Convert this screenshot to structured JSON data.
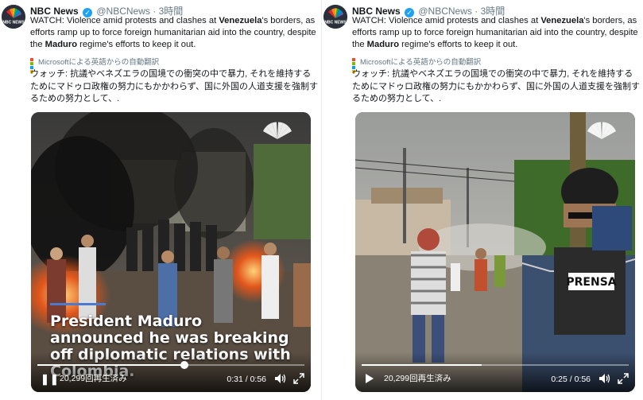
{
  "tweets": [
    {
      "author_name": "NBC News",
      "handle": "@NBCNews",
      "separator": "·",
      "time_ago": "3時間",
      "text_parts": [
        "WATCH: Violence amid protests and clashes at ",
        "Venezuela",
        "'s borders, as efforts ramp up to force foreign humanitarian aid into the country, despite the ",
        "Maduro",
        " regime's efforts to keep it out."
      ],
      "translate_brand": "Microsoft",
      "translate_label": "による英語からの自動翻訳",
      "translated_text": "ウォッチ: 抗議やベネズエラの国境での衝突の中で暴力, それを維持するためにマドゥロ政権の努力にもかかわらず、国に外国の人道支援を強制するための努力として、.",
      "video": {
        "caption": "President Maduro announced he was breaking off diplomatic relations with Colombia.",
        "views": "20,299回再生済み",
        "current_time": "0:31",
        "duration": "0:56",
        "progress_fraction": 0.55,
        "state": "playing"
      }
    },
    {
      "author_name": "NBC News",
      "handle": "@NBCNews",
      "separator": "·",
      "time_ago": "3時間",
      "text_parts": [
        "WATCH: Violence amid protests and clashes at ",
        "Venezuela",
        "'s borders, as efforts ramp up to force foreign humanitarian aid into the country, despite the ",
        "Maduro",
        " regime's efforts to keep it out."
      ],
      "translate_brand": "Microsoft",
      "translate_label": "による英語からの自動翻訳",
      "translated_text": "ウォッチ: 抗議やベネズエラの国境での衝突の中で暴力, それを維持するためにマドゥロ政権の努力にもかかわらず、国に外国の人道支援を強制するための努力として、.",
      "video": {
        "caption": "",
        "vest_text": "PRENSA",
        "views": "20,299回再生済み",
        "current_time": "0:25",
        "duration": "0:56",
        "progress_fraction": 0.45,
        "state": "paused"
      }
    }
  ],
  "colors": {
    "link_bold": "#14171a",
    "verified": "#1da1f2",
    "muted": "#657786",
    "caption_bar": "#4a7bd1"
  },
  "icons": [
    "nbc-peacock-icon",
    "verified-badge-icon",
    "caret-down-icon",
    "microsoft-logo-icon",
    "pause-icon",
    "play-icon",
    "volume-icon",
    "fullscreen-icon"
  ]
}
